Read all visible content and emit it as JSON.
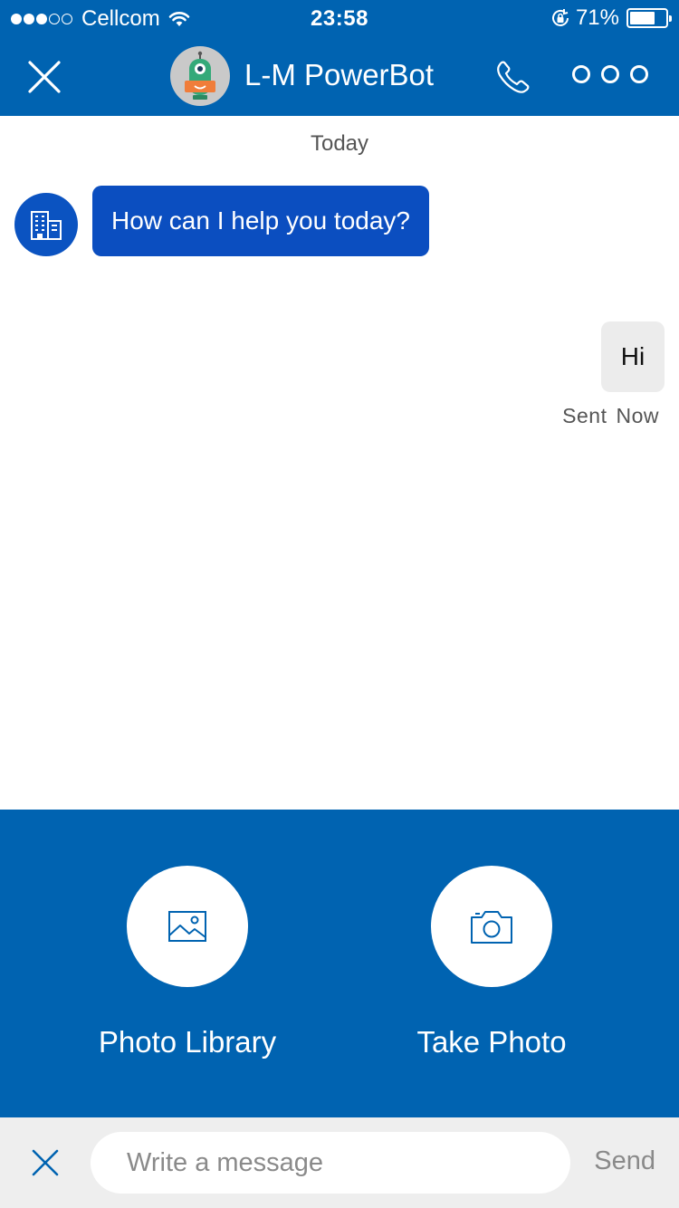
{
  "status_bar": {
    "carrier": "Cellcom",
    "time": "23:58",
    "battery_percent": "71%",
    "battery_level": 0.71,
    "signal_bars_filled": 3,
    "signal_bars_total": 5
  },
  "header": {
    "title": "L-M PowerBot",
    "close_icon": "close-icon",
    "call_icon": "phone-icon",
    "more_icon": "more-options-icon",
    "color": "#0063b1"
  },
  "conversation": {
    "day_label": "Today",
    "messages": [
      {
        "from": "bot",
        "text": "How can I help you today?"
      },
      {
        "from": "user",
        "text": "Hi"
      }
    ],
    "receipt": {
      "status": "Sent",
      "time": "Now"
    }
  },
  "attachments": {
    "photo_library_label": "Photo Library",
    "take_photo_label": "Take Photo"
  },
  "compose": {
    "placeholder": "Write a message",
    "send_label": "Send"
  }
}
